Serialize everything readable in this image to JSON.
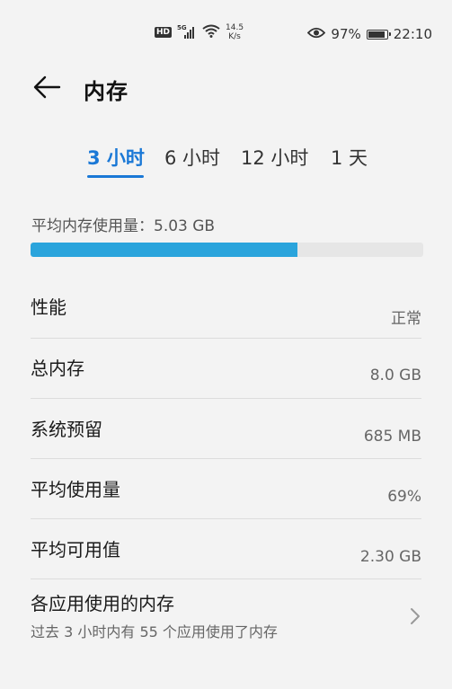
{
  "status_bar": {
    "hd_badge": "HD",
    "signal_type": "5G",
    "net_speed_value": "14.5",
    "net_speed_unit": "K/s",
    "battery_percent": "97%",
    "time": "22:10",
    "icons": [
      "hd-icon",
      "signal-icon",
      "wifi-icon",
      "eye-icon",
      "battery-icon"
    ]
  },
  "header": {
    "title": "内存",
    "back_icon": "back-arrow-icon"
  },
  "tabs": [
    {
      "label": "3 小时",
      "active": true
    },
    {
      "label": "6 小时",
      "active": false
    },
    {
      "label": "12 小时",
      "active": false
    },
    {
      "label": "1 天",
      "active": false
    }
  ],
  "usage": {
    "label": "平均内存使用量：5.03 GB",
    "fill_fraction": 0.68,
    "accent_color": "#2aa4dc"
  },
  "rows": [
    {
      "label": "性能",
      "value": "正常"
    },
    {
      "label": "总内存",
      "value": "8.0 GB"
    },
    {
      "label": "系统预留",
      "value": "685 MB"
    },
    {
      "label": "平均使用量",
      "value": "69%"
    },
    {
      "label": "平均可用值",
      "value": "2.30 GB"
    }
  ],
  "app_memory": {
    "title": "各应用使用的内存",
    "subtitle": "过去 3 小时内有 55 个应用使用了内存",
    "icon": "chevron-right-icon"
  }
}
